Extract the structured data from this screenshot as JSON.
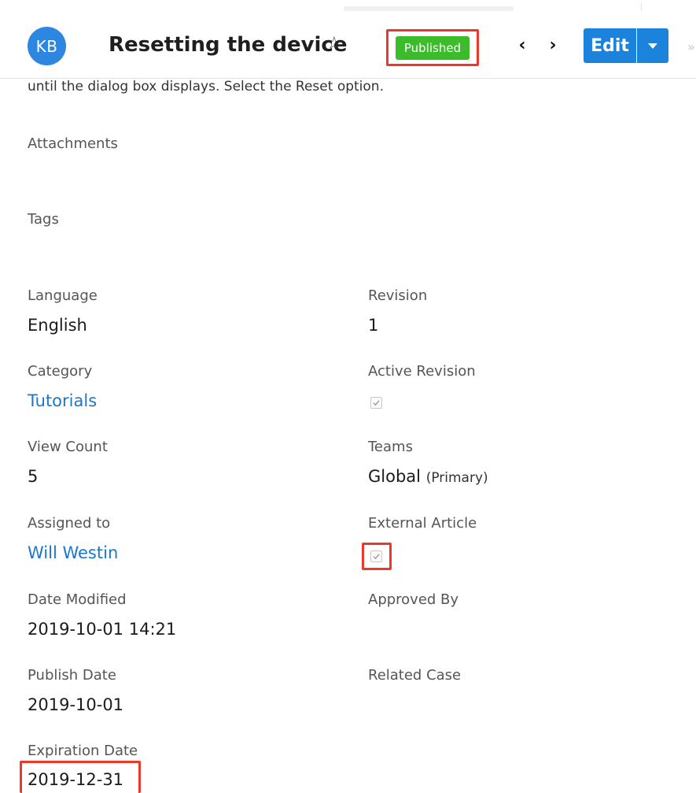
{
  "header": {
    "avatar": "KB",
    "title": "Resetting the device",
    "favorite_icon": "star-icon",
    "status": "Published",
    "status_color": "#3cbc2a",
    "prev_icon": "chevron-left-icon",
    "next_icon": "chevron-right-icon",
    "edit_label": "Edit",
    "accent": "#1b83dc"
  },
  "description_tail": "until the dialog box displays. Select the Reset option.",
  "sections": {
    "attachments": "Attachments",
    "tags": "Tags"
  },
  "fields": {
    "language": {
      "label": "Language",
      "value": "English"
    },
    "revision": {
      "label": "Revision",
      "value": "1"
    },
    "category": {
      "label": "Category",
      "value": "Tutorials"
    },
    "active_revision": {
      "label": "Active Revision",
      "checked": true
    },
    "view_count": {
      "label": "View Count",
      "value": "5"
    },
    "teams": {
      "label": "Teams",
      "value": "Global",
      "note": "(Primary)"
    },
    "assigned_to": {
      "label": "Assigned to",
      "value": "Will Westin"
    },
    "external_article": {
      "label": "External Article",
      "checked": true
    },
    "date_modified": {
      "label": "Date Modified",
      "value": "2019-10-01 14:21"
    },
    "approved_by": {
      "label": "Approved By"
    },
    "publish_date": {
      "label": "Publish Date",
      "value": "2019-10-01"
    },
    "related_case": {
      "label": "Related Case"
    },
    "expiration_date": {
      "label": "Expiration Date",
      "value": "2019-12-31"
    }
  },
  "highlight_color": "#e8392b"
}
